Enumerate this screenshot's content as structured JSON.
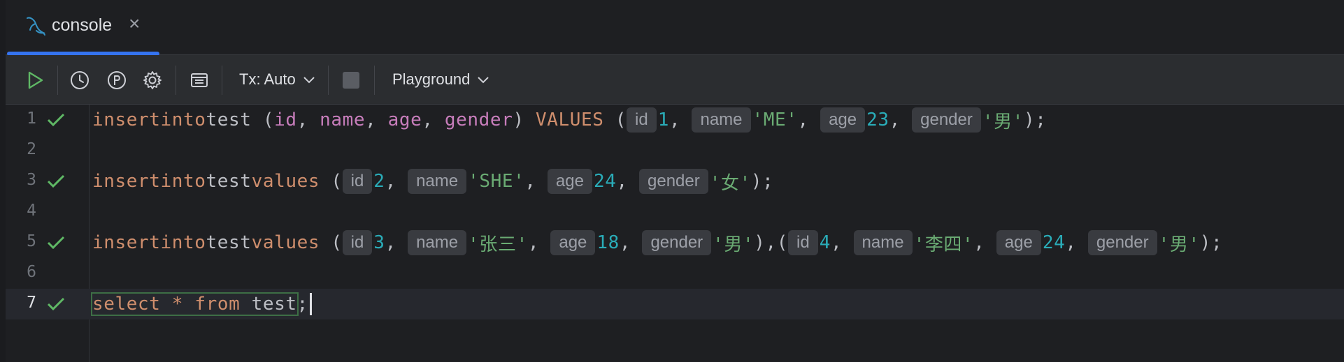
{
  "tab": {
    "label": "console",
    "close": "×"
  },
  "toolbar": {
    "tx_label": "Tx: Auto",
    "playground_label": "Playground"
  },
  "editor": {
    "lines": [
      {
        "num": "1",
        "status": "ok"
      },
      {
        "num": "2",
        "status": ""
      },
      {
        "num": "3",
        "status": "ok"
      },
      {
        "num": "4",
        "status": ""
      },
      {
        "num": "5",
        "status": "ok"
      },
      {
        "num": "6",
        "status": ""
      },
      {
        "num": "7",
        "status": "ok"
      }
    ],
    "l1": {
      "insert": "insert",
      "into": "into",
      "table": "test",
      "open": " (",
      "c1": "id",
      "c2": "name",
      "c3": "age",
      "c4": "gender",
      "comma": ", ",
      "close": ") ",
      "values": "VALUES",
      "vopen": " (",
      "h1": "id",
      "v1": "1",
      "h2": "name",
      "v2": "'ME'",
      "h3": "age",
      "v3": "23",
      "h4": "gender",
      "v4": "'男'",
      "end": ");"
    },
    "l3": {
      "insert": "insert",
      "into": "into",
      "table": "test",
      "values": "values",
      "open": " (",
      "h1": "id",
      "v1": "2",
      "h2": "name",
      "v2": "'SHE'",
      "h3": "age",
      "v3": "24",
      "h4": "gender",
      "v4": "'女'",
      "end": ");"
    },
    "l5": {
      "insert": "insert",
      "into": "into",
      "table": "test",
      "values": "values",
      "open": " (",
      "h1": "id",
      "v1": "3",
      "h2": "name",
      "v2": "'张三'",
      "h3": "age",
      "v3": "18",
      "h4": "gender",
      "v4": "'男'",
      "mid": "),(",
      "h5": "id",
      "v5": "4",
      "h6": "name",
      "v6": "'李四'",
      "h7": "age",
      "v7": "24",
      "h8": "gender",
      "v8": "'男'",
      "end": ");"
    },
    "l7": {
      "select": "select",
      "star": "*",
      "from": "from",
      "table": "test",
      "semi": ";"
    }
  },
  "colors": {
    "keyword": "#cf8e6d",
    "column": "#c77dbb",
    "number": "#2aacb8",
    "string": "#6aab73",
    "accent": "#3574f0",
    "success": "#5fb865"
  },
  "icons": [
    "mysql-dolphin-icon",
    "close-icon",
    "run-icon",
    "history-icon",
    "parameters-icon",
    "settings-icon",
    "layout-icon",
    "chevron-down-icon",
    "stop-icon",
    "check-icon"
  ]
}
